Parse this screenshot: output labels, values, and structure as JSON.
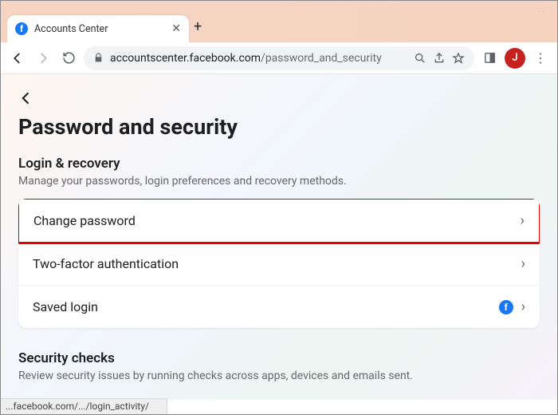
{
  "window": {
    "tab_title": "Accounts Center",
    "avatar_initial": "J"
  },
  "url": {
    "host": "accountscenter.facebook.com",
    "path": "/password_and_security"
  },
  "page": {
    "title": "Password and security"
  },
  "login_recovery": {
    "title": "Login & recovery",
    "desc": "Manage your passwords, login preferences and recovery methods.",
    "items": {
      "change_password": "Change password",
      "two_factor": "Two-factor authentication",
      "saved_login": "Saved login"
    }
  },
  "security_checks": {
    "title": "Security checks",
    "desc": "Review security issues by running checks across apps, devices and emails sent."
  },
  "status": "...facebook.com/.../login_activity/"
}
